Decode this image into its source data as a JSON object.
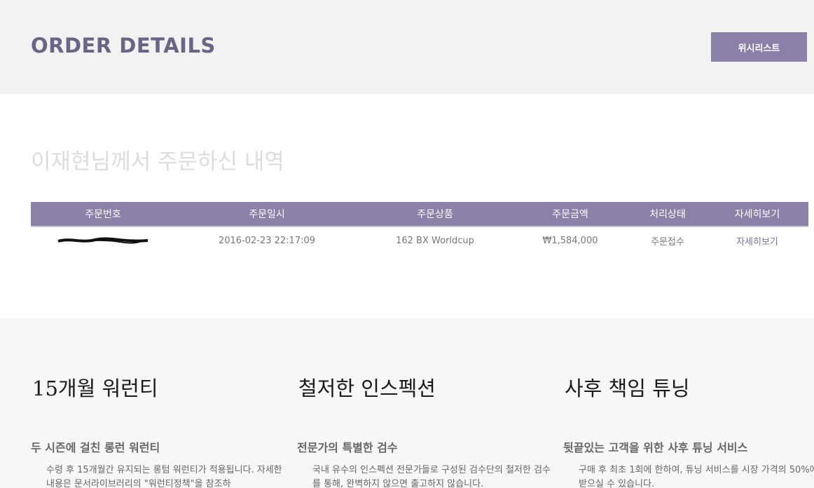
{
  "header": {
    "title": "ORDER DETAILS",
    "wishlist_label": "위시리스트"
  },
  "section": {
    "heading": "이재현님께서 주문하신 내역"
  },
  "table": {
    "columns": [
      "주문번호",
      "주문일시",
      "주문상품",
      "주문금액",
      "처리상태",
      "자세히보기"
    ],
    "rows": [
      {
        "order_no": "",
        "date": "2016-02-23 22:17:09",
        "product": "162 BX Worldcup",
        "amount": "₩1,584,000",
        "status": "주문접수",
        "detail": "자세히보기"
      }
    ]
  },
  "features": [
    {
      "title": "15개월 워런티",
      "subtitle": "두 시즌에 걸친 롱런 워런티",
      "body": "수령 후 15개월간 유지되는 롱텀 워런티가 적용됩니다. 자세한 내용은 문서라이브러리의 \"워런티정책\"을 참조하"
    },
    {
      "title": "철저한 인스펙션",
      "subtitle": "전문가의 특별한 검수",
      "body": "국내 유수의 인스펙션 전문가들로 구성된 검수단의 철저한 검수를 통해, 완벽하지 않으면 출고하지 않습니다."
    },
    {
      "title": "사후 책임 튜닝",
      "subtitle": "뒷끝있는 고객을 위한 사후 튜닝 서비스",
      "body": "구매 후 최초 1회에 한하여, 튜닝 서비스를 시장 가격의 50%에 받으실 수 있습니다."
    }
  ]
}
